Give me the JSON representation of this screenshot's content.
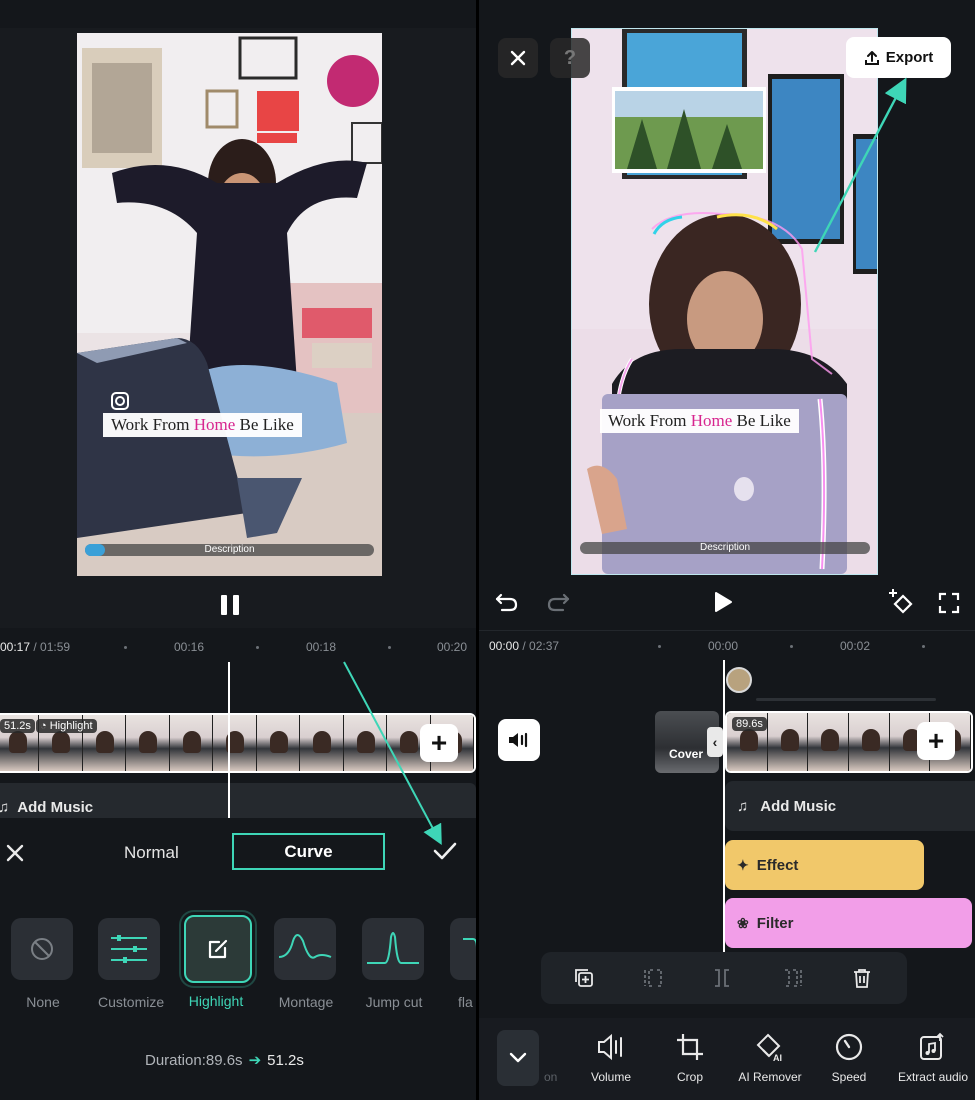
{
  "left_editor": {
    "video": {
      "caption_part1": "Work From ",
      "caption_accent": "Home",
      "caption_part2": " Be Like",
      "description": "Description",
      "progress": 0.07
    },
    "timeline": {
      "current_time": "00:17",
      "total_time": "/ 01:59",
      "ruler": [
        "00:16",
        "00:18",
        "00:20"
      ],
      "clip_duration": "51.2s",
      "clip_tag": "Highlight",
      "add_music": "Add Music"
    },
    "mode_tabs": [
      "Normal",
      "Curve"
    ],
    "active_mode": "Curve",
    "presets": [
      "None",
      "Customize",
      "Highlight",
      "Montage",
      "Jump cut",
      "fla"
    ],
    "selected_preset": "Highlight",
    "duration": {
      "label": "Duration:89.6s",
      "new_value": "51.2s"
    }
  },
  "right_editor": {
    "export_label": "Export",
    "video": {
      "caption_part1": "Work From ",
      "caption_accent": "Home",
      "caption_part2": " Be Like",
      "description": "Description"
    },
    "timeline": {
      "current_time": "00:00",
      "total_time": "/ 02:37",
      "ruler": [
        "00:00",
        "00:02"
      ],
      "cover_label": "Cover",
      "clip_duration": "89.6s",
      "add_music": "Add Music",
      "effect": "Effect",
      "filter": "Filter"
    },
    "bottom_tools": [
      "Volume",
      "Crop",
      "AI Remover",
      "Speed",
      "Extract audio"
    ],
    "partial_tool": "on"
  },
  "colors": {
    "accent_teal": "#3ed6b7",
    "effect_track": "#f1c86a",
    "filter_track": "#f29ee8",
    "caption_accent": "#d7258f"
  }
}
